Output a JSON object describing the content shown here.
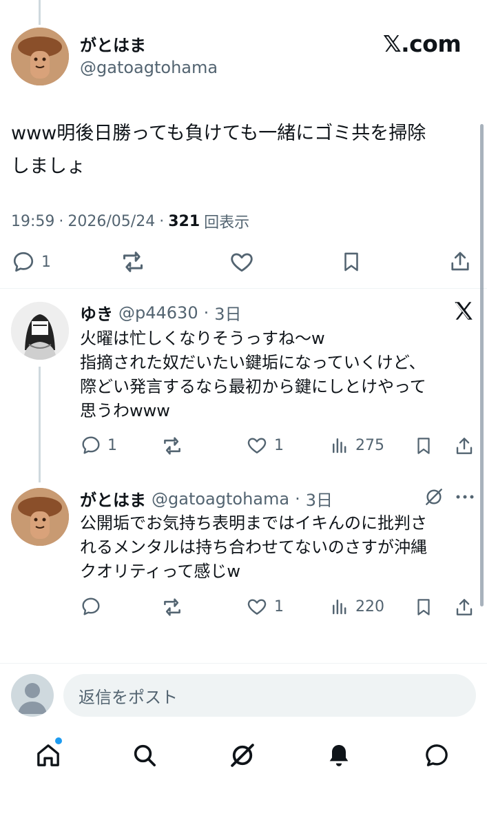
{
  "main_tweet": {
    "author_name": "がとはま",
    "author_handle": "@gatoagtohama",
    "brand": "𝕏.com",
    "text": "www明後日勝っても負けても一緒にゴミ共を掃除\nしましょ",
    "time": "19:59",
    "date": "2026/05/24",
    "views_count": "321",
    "views_label": "回表示",
    "reply_count": "1"
  },
  "replies": [
    {
      "author_name": "ゆき",
      "author_handle": "@p44630",
      "age": "3日",
      "text": "火曜は忙しくなりそうっすね〜w\n指摘された奴だいたい鍵垢になっていくけど、\n際どい発言するなら最初から鍵にしとけやって\n思うわwww",
      "reply_count": "1",
      "like_count": "1",
      "view_count": "275"
    },
    {
      "author_name": "がとはま",
      "author_handle": "@gatoagtohama",
      "age": "3日",
      "text": "公開垢でお気持ち表明まではイキんのに批判さ\nれるメンタルは持ち合わせてないのさすが沖縄\nクオリティって感じw",
      "like_count": "1",
      "view_count": "220"
    }
  ],
  "composer": {
    "placeholder": "返信をポスト"
  },
  "icons": {
    "reply": "speech-bubble-icon",
    "retweet": "retweet-icon",
    "like": "heart-icon",
    "bookmark": "bookmark-icon",
    "share": "share-icon",
    "views": "bar-chart-icon",
    "grok": "grok-icon",
    "more": "more-icon",
    "x_logo": "x-logo-icon",
    "home": "home-icon",
    "search": "search-icon",
    "notifications": "bell-icon",
    "messages": "message-icon"
  },
  "colors": {
    "text": "#0f1419",
    "muted": "#536471",
    "accent": "#1d9bf0",
    "divider": "#eff3f4",
    "input_bg": "#eff3f4"
  }
}
